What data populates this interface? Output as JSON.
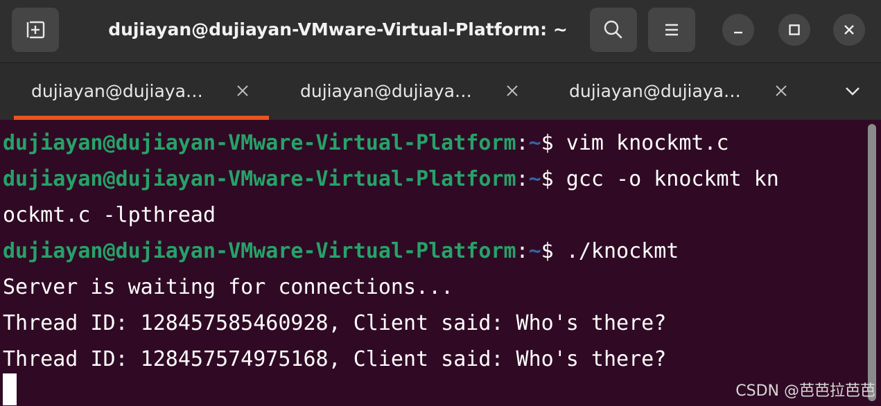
{
  "window": {
    "title": "dujiayan@dujiayan-VMware-Virtual-Platform: ~"
  },
  "header": {
    "new_tab_icon": "new-tab-icon",
    "search_icon": "search-icon",
    "menu_icon": "hamburger-menu-icon",
    "minimize_icon": "minimize-icon",
    "maximize_icon": "maximize-icon",
    "close_icon": "close-icon"
  },
  "tabs": [
    {
      "label": "dujiayan@dujiaya…",
      "active": true
    },
    {
      "label": "dujiayan@dujiaya…",
      "active": false
    },
    {
      "label": "dujiayan@dujiaya…",
      "active": false
    }
  ],
  "terminal": {
    "lines": [
      {
        "user": "dujiayan@dujiayan-VMware-Virtual-Platform",
        "colon": ":",
        "path": "~",
        "cmd": "$ vim knockmt.c"
      },
      {
        "user": "dujiayan@dujiayan-VMware-Virtual-Platform",
        "colon": ":",
        "path": "~",
        "cmd": "$ gcc -o knockmt kn"
      },
      {
        "text": "ockmt.c -lpthread"
      },
      {
        "user": "dujiayan@dujiayan-VMware-Virtual-Platform",
        "colon": ":",
        "path": "~",
        "cmd": "$ ./knockmt"
      },
      {
        "text": "Server is waiting for connections..."
      },
      {
        "text": "Thread ID: 128457585460928, Client said: Who's there?"
      },
      {
        "text": "Thread ID: 128457574975168, Client said: Who's there?"
      }
    ]
  },
  "colors": {
    "terminal_bg": "#300a24",
    "prompt_user": "#26a269",
    "prompt_path": "#3465a4",
    "tab_indicator": "#e95420"
  },
  "watermark": "CSDN @芭芭拉芭芭"
}
